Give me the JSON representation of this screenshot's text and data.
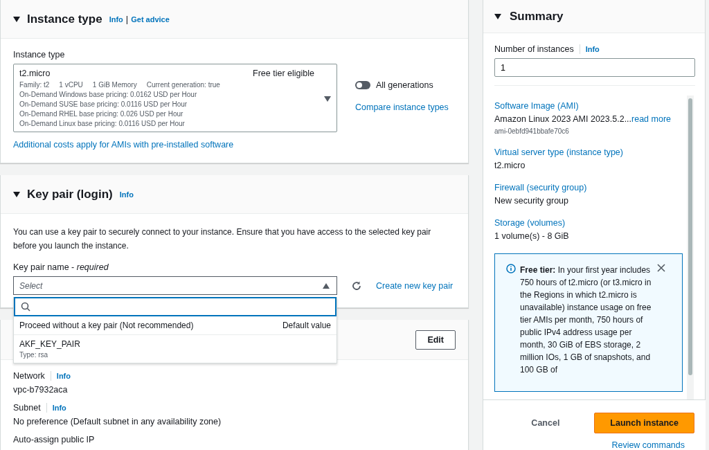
{
  "instance_type_panel": {
    "title": "Instance type",
    "expanded": true,
    "info": "Info",
    "separator": "|",
    "get_advice": "Get advice",
    "field_label": "Instance type",
    "select": {
      "value": "t2.micro",
      "badge": "Free tier eligible",
      "specs": [
        "Family: t2",
        "1 vCPU",
        "1 GiB Memory",
        "Current generation: true"
      ],
      "pricing": [
        "On-Demand Windows base pricing: 0.0162 USD per Hour",
        "On-Demand SUSE base pricing: 0.0116 USD per Hour",
        "On-Demand RHEL base pricing: 0.026 USD per Hour",
        "On-Demand Linux base pricing: 0.0116 USD per Hour"
      ]
    },
    "toggle": {
      "label": "All generations",
      "on": false
    },
    "compare_link": "Compare instance types",
    "costs_link": "Additional costs apply for AMIs with pre-installed software"
  },
  "key_pair_panel": {
    "title": "Key pair (login)",
    "expanded": true,
    "info": "Info",
    "description": "You can use a key pair to securely connect to your instance. Ensure that you have access to the selected key pair before you launch the instance.",
    "field_label": "Key pair name - *required*",
    "select": {
      "placeholder": "Select",
      "expanded": true
    },
    "create_link": "Create new key pair",
    "options": [
      {
        "label": "Proceed without a key pair (Not recommended)",
        "tag": "Default value"
      },
      {
        "label": "AKF_KEY_PAIR",
        "description": "Type: rsa"
      }
    ]
  },
  "network_panel": {
    "edit_button": "Edit",
    "fields": [
      {
        "label": "Network",
        "info": "Info",
        "value": "vpc-b7932aca"
      },
      {
        "label": "Subnet",
        "info": "Info",
        "value": "No preference (Default subnet in any availability zone)"
      },
      {
        "label": "Auto-assign public IP"
      }
    ]
  },
  "summary": {
    "title": "Summary",
    "expanded": true,
    "instances_label": "Number of instances",
    "instances_info": "Info",
    "instances_value": "1",
    "items": [
      {
        "label": "Software Image (AMI)",
        "value": "Amazon Linux 2023 AMI 2023.5.2...",
        "link": "read more",
        "sub": "ami-0ebfd941bbafe70c6"
      },
      {
        "label": "Virtual server type (instance type)",
        "value": "t2.micro"
      },
      {
        "label": "Firewall (security group)",
        "value": "New security group"
      },
      {
        "label": "Storage (volumes)",
        "value": "1 volume(s) - 8 GiB"
      }
    ],
    "alert": "**Free tier:** In your first year includes 750 hours of t2.micro (or t3.micro in the Regions in which t2.micro is unavailable) instance usage on free tier AMIs per month, 750 hours of public IPv4 address usage per month, 30 GiB of EBS storage, 2 million IOs, 1 GB of snapshots, and 100 GB of",
    "cancel": "Cancel",
    "launch": "Launch instance",
    "review": "Review commands"
  }
}
